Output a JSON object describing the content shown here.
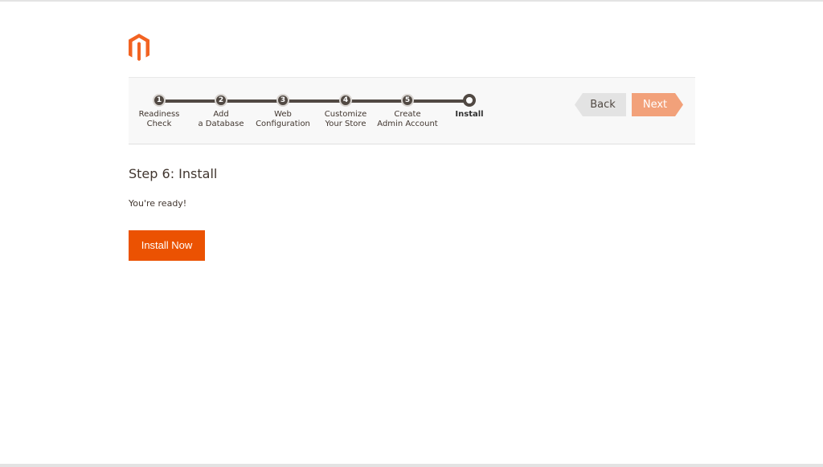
{
  "brand": {
    "logo": "magento-logo",
    "accent": "#eb5202"
  },
  "steps": [
    {
      "num": "1",
      "label1": "Readiness",
      "label2": "Check"
    },
    {
      "num": "2",
      "label1": "Add",
      "label2": "a Database"
    },
    {
      "num": "3",
      "label1": "Web",
      "label2": "Configuration"
    },
    {
      "num": "4",
      "label1": "Customize",
      "label2": "Your Store"
    },
    {
      "num": "5",
      "label1": "Create",
      "label2": "Admin Account"
    },
    {
      "num": "",
      "label1": "Install",
      "label2": ""
    }
  ],
  "nav": {
    "back": "Back",
    "next": "Next"
  },
  "main": {
    "title": "Step 6: Install",
    "message": "You're ready!",
    "install_button": "Install Now"
  }
}
